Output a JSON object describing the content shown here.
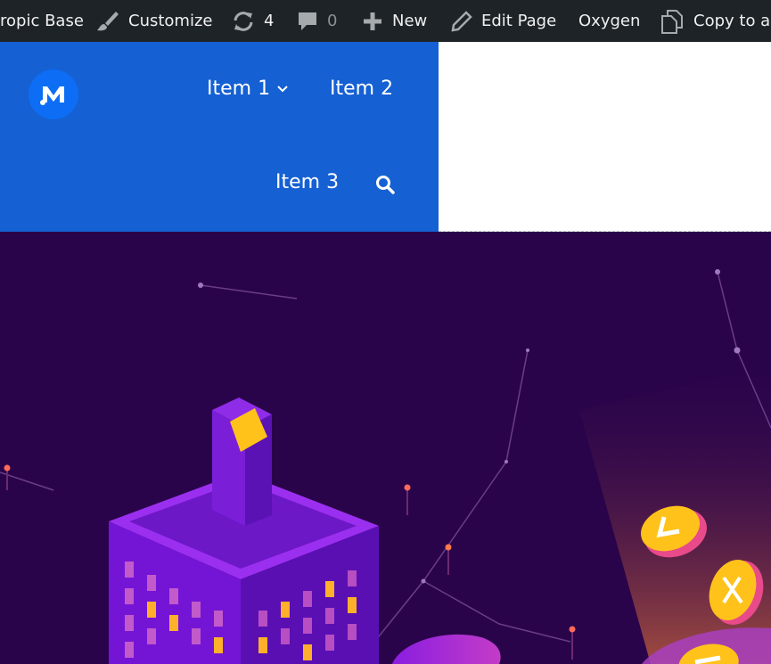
{
  "admin_bar": {
    "site_name": "ropic Base",
    "customize": "Customize",
    "updates_count": "4",
    "comments_count": "0",
    "new": "New",
    "edit_page": "Edit Page",
    "oxygen": "Oxygen",
    "copy": "Copy to a"
  },
  "nav": {
    "logo_letter": "M",
    "items": [
      {
        "label": "Item 1"
      },
      {
        "label": "Item 2"
      },
      {
        "label": "Item 3"
      }
    ]
  },
  "colors": {
    "admin_bar_bg": "#1d2327",
    "nav_bg": "#1560d3",
    "hero_bg": "#2a044a",
    "coin_yellow": "#ffc21a",
    "building_purple": "#7d1fd6"
  },
  "icons": [
    "paintbrush-icon",
    "refresh-icon",
    "comment-icon",
    "plus-icon",
    "pencil-icon",
    "copy-icon",
    "chevron-down-icon",
    "search-icon"
  ]
}
